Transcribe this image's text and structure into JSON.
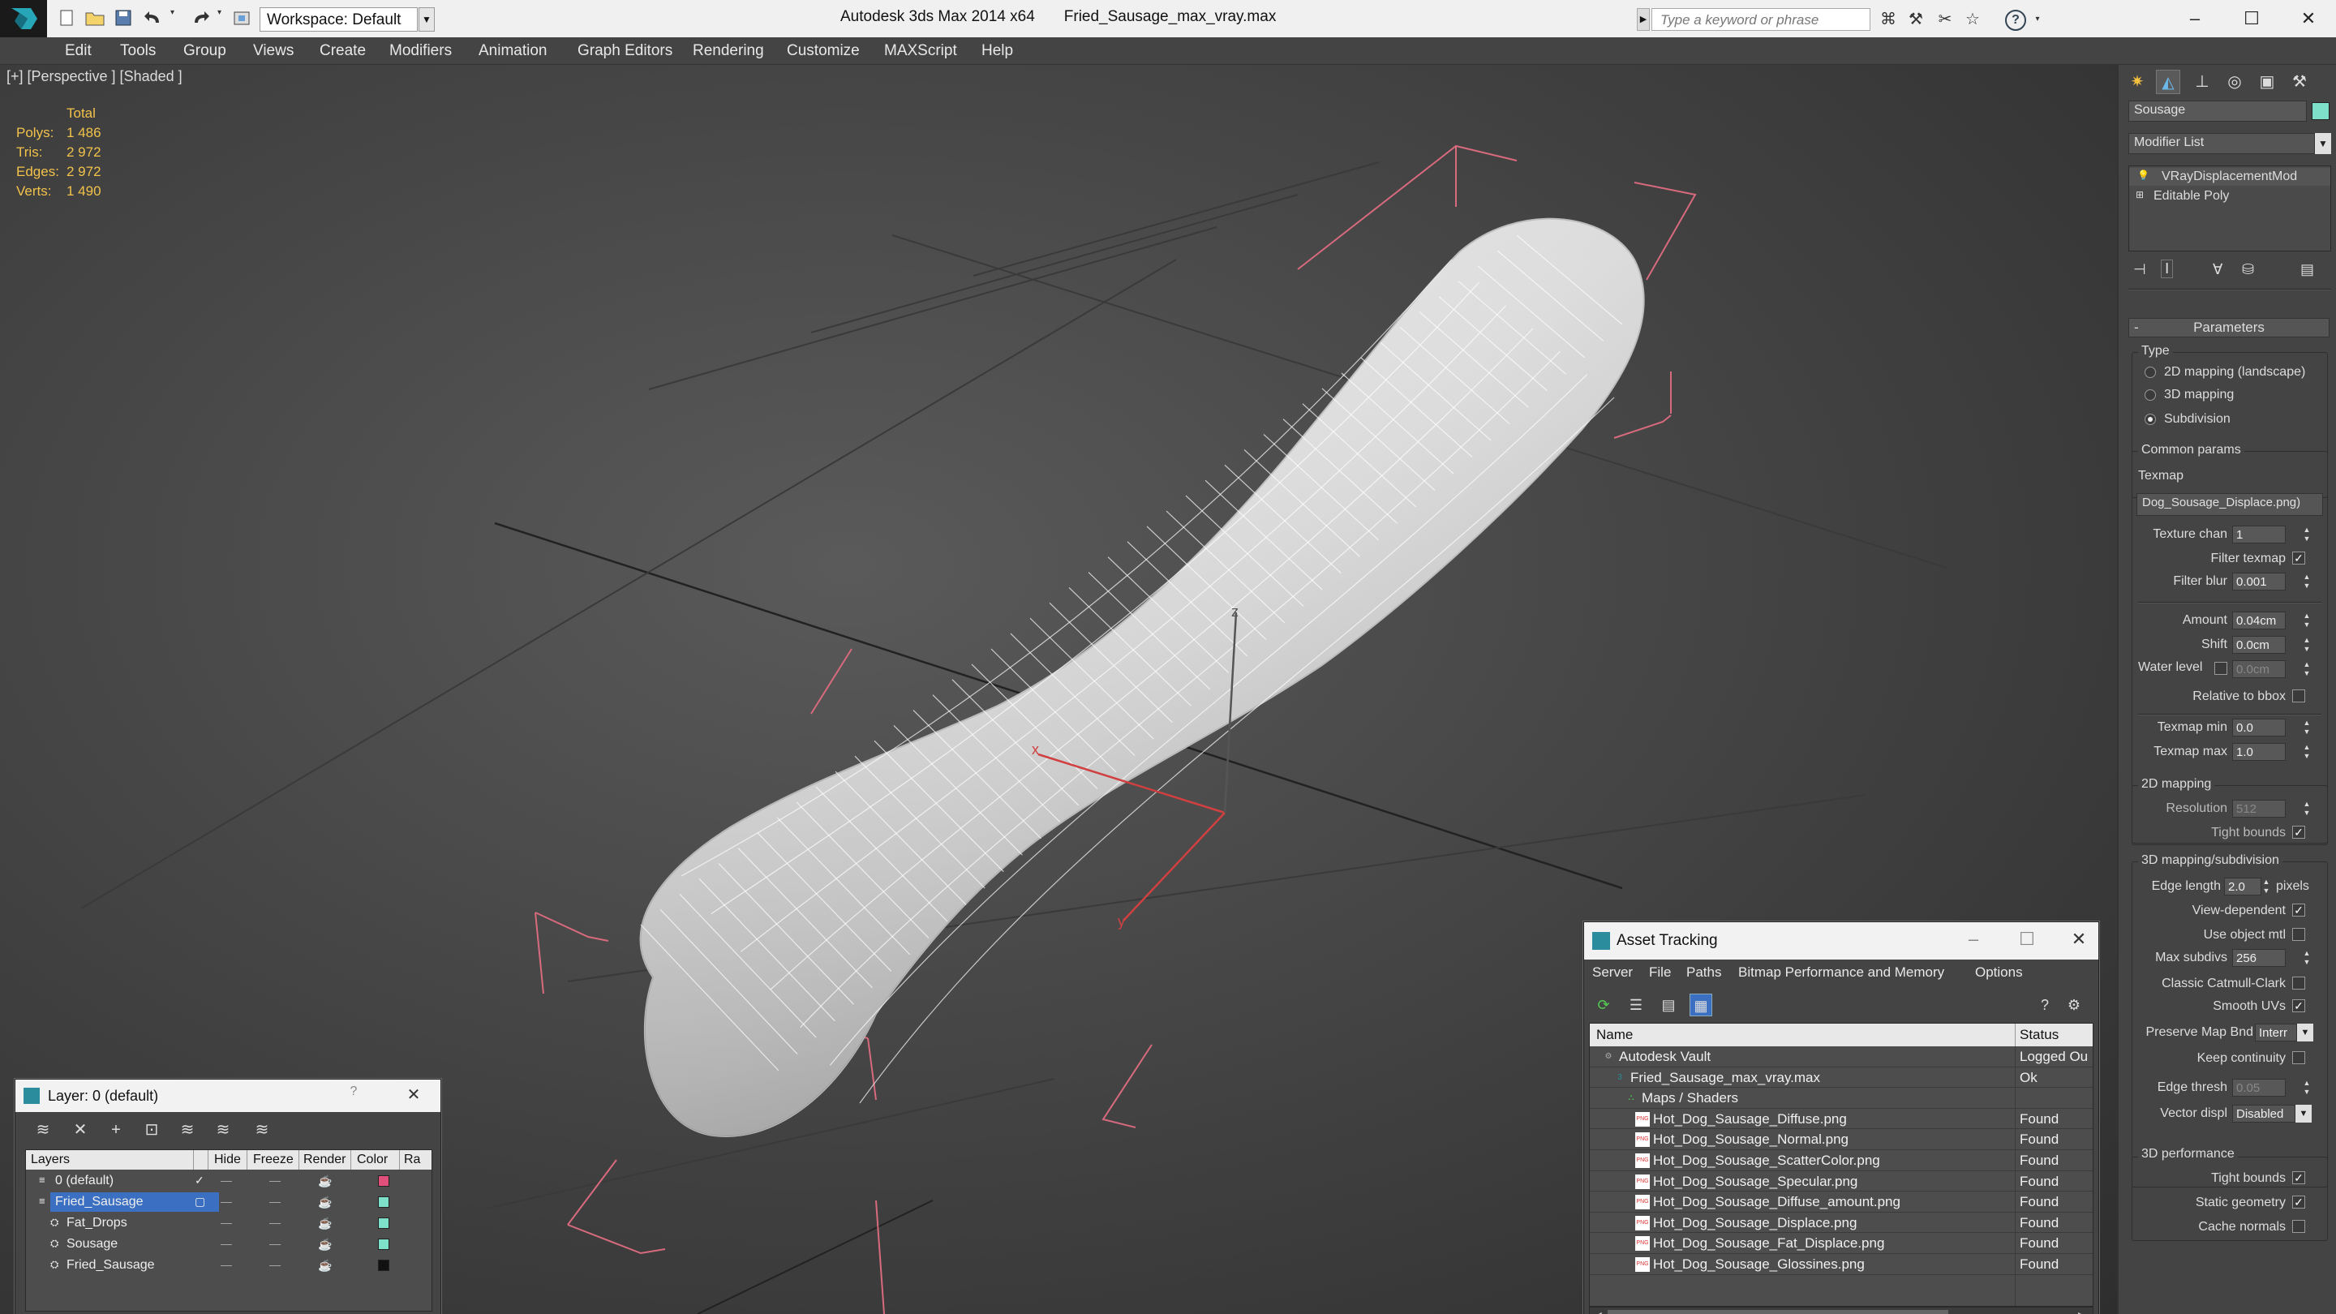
{
  "app": {
    "title": "Autodesk 3ds Max 2014 x64",
    "file": "Fried_Sausage_max_vray.max",
    "workspace": "Workspace: Default",
    "search_placeholder": "Type a keyword or phrase"
  },
  "menu": [
    "Edit",
    "Tools",
    "Group",
    "Views",
    "Create",
    "Modifiers",
    "Animation",
    "Graph Editors",
    "Rendering",
    "Customize",
    "MAXScript",
    "Help"
  ],
  "viewport": {
    "label": "[+] [Perspective ] [Shaded ]",
    "stats": {
      "header": "Total",
      "rows": [
        {
          "label": "Polys:",
          "value": "1 486"
        },
        {
          "label": "Tris:",
          "value": "2 972"
        },
        {
          "label": "Edges:",
          "value": "2 972"
        },
        {
          "label": "Verts:",
          "value": "1 490"
        }
      ]
    },
    "gizmo_axes": {
      "x": "x",
      "y": "y",
      "z": "z"
    }
  },
  "command_panel": {
    "object_name": "Sousage",
    "object_color": "#7ee0c8",
    "modifier_list": "Modifier List",
    "stack": [
      "VRayDisplacementMod",
      "Editable Poly"
    ],
    "parameters_title": "Parameters",
    "type_label": "Type",
    "type_options": [
      {
        "label": "2D mapping (landscape)",
        "selected": false
      },
      {
        "label": "3D mapping",
        "selected": false
      },
      {
        "label": "Subdivision",
        "selected": true
      }
    ],
    "common_params": "Common params",
    "texmap_label": "Texmap",
    "texmap_value": "Dog_Sousage_Displace.png)",
    "texture_chan": {
      "label": "Texture chan",
      "value": "1"
    },
    "filter_texmap": {
      "label": "Filter texmap",
      "checked": true
    },
    "filter_blur": {
      "label": "Filter blur",
      "value": "0.001"
    },
    "amount": {
      "label": "Amount",
      "value": "0.04cm"
    },
    "shift": {
      "label": "Shift",
      "value": "0.0cm"
    },
    "water_level": {
      "label": "Water level",
      "value": "0.0cm",
      "checked": false
    },
    "relative_to_bbox": {
      "label": "Relative to bbox",
      "checked": false
    },
    "texmap_min": {
      "label": "Texmap min",
      "value": "0.0"
    },
    "texmap_max": {
      "label": "Texmap max",
      "value": "1.0"
    },
    "mapping_2d": "2D mapping",
    "resolution": {
      "label": "Resolution",
      "value": "512"
    },
    "tight_bounds_2d": {
      "label": "Tight bounds",
      "checked": true
    },
    "mapping_3d": "3D mapping/subdivision",
    "edge_length": {
      "label": "Edge length",
      "value": "2.0",
      "unit": "pixels"
    },
    "view_dependent": {
      "label": "View-dependent",
      "checked": true
    },
    "use_object_mtl": {
      "label": "Use object mtl",
      "checked": false
    },
    "max_subdivs": {
      "label": "Max subdivs",
      "value": "256"
    },
    "classic_catmull": {
      "label": "Classic Catmull-Clark",
      "checked": false
    },
    "smooth_uvs": {
      "label": "Smooth UVs",
      "checked": true
    },
    "preserve_map_bnd": {
      "label": "Preserve Map Bnd",
      "value": "Interr"
    },
    "keep_continuity": {
      "label": "Keep continuity",
      "checked": false
    },
    "edge_thresh": {
      "label": "Edge thresh",
      "value": "0.05"
    },
    "vector_displ": {
      "label": "Vector displ",
      "value": "Disabled"
    },
    "perf_3d": "3D performance",
    "tight_bounds_3d": {
      "label": "Tight bounds",
      "checked": true
    },
    "static_geometry": {
      "label": "Static geometry",
      "checked": true
    },
    "cache_normals": {
      "label": "Cache normals",
      "checked": false
    }
  },
  "asset_tracking": {
    "title": "Asset Tracking",
    "menu": [
      "Server",
      "File",
      "Paths",
      "Bitmap Performance and Memory",
      "Options"
    ],
    "col_name": "Name",
    "col_status": "Status",
    "rows": [
      {
        "name": "Autodesk Vault",
        "status": "Logged Ou",
        "indent": 0,
        "icon": "vault"
      },
      {
        "name": "Fried_Sausage_max_vray.max",
        "status": "Ok",
        "indent": 1,
        "icon": "max"
      },
      {
        "name": "Maps / Shaders",
        "status": "",
        "indent": 2,
        "icon": "maps"
      },
      {
        "name": "Hot_Dog_Sausage_Diffuse.png",
        "status": "Found",
        "indent": 3,
        "icon": "png"
      },
      {
        "name": "Hot_Dog_Sousage_Normal.png",
        "status": "Found",
        "indent": 3,
        "icon": "png"
      },
      {
        "name": "Hot_Dog_Sousage_ScatterColor.png",
        "status": "Found",
        "indent": 3,
        "icon": "png"
      },
      {
        "name": "Hot_Dog_Sousage_Specular.png",
        "status": "Found",
        "indent": 3,
        "icon": "png"
      },
      {
        "name": "Hot_Dog_Sousage_Diffuse_amount.png",
        "status": "Found",
        "indent": 3,
        "icon": "png"
      },
      {
        "name": "Hot_Dog_Sousage_Displace.png",
        "status": "Found",
        "indent": 3,
        "icon": "png"
      },
      {
        "name": "Hot_Dog_Sousage_Fat_Displace.png",
        "status": "Found",
        "indent": 3,
        "icon": "png"
      },
      {
        "name": "Hot_Dog_Sousage_Glossines.png",
        "status": "Found",
        "indent": 3,
        "icon": "png"
      }
    ]
  },
  "layer_window": {
    "title": "Layer: 0 (default)",
    "help": "?",
    "columns": [
      "Layers",
      "Hide",
      "Freeze",
      "Render",
      "Color",
      "Ra"
    ],
    "rows": [
      {
        "name": "0 (default)",
        "indent": 0,
        "color": "#e0507a",
        "current": true,
        "selected": false
      },
      {
        "name": "Fried_Sausage",
        "indent": 0,
        "color": "#7ee0c8",
        "current": false,
        "selected": true
      },
      {
        "name": "Fat_Drops",
        "indent": 1,
        "color": "#7ee0c8",
        "current": false,
        "selected": false
      },
      {
        "name": "Sousage",
        "indent": 1,
        "color": "#7ee0c8",
        "current": false,
        "selected": false
      },
      {
        "name": "Fried_Sausage",
        "indent": 1,
        "color": "#111111",
        "current": false,
        "selected": false
      }
    ]
  }
}
